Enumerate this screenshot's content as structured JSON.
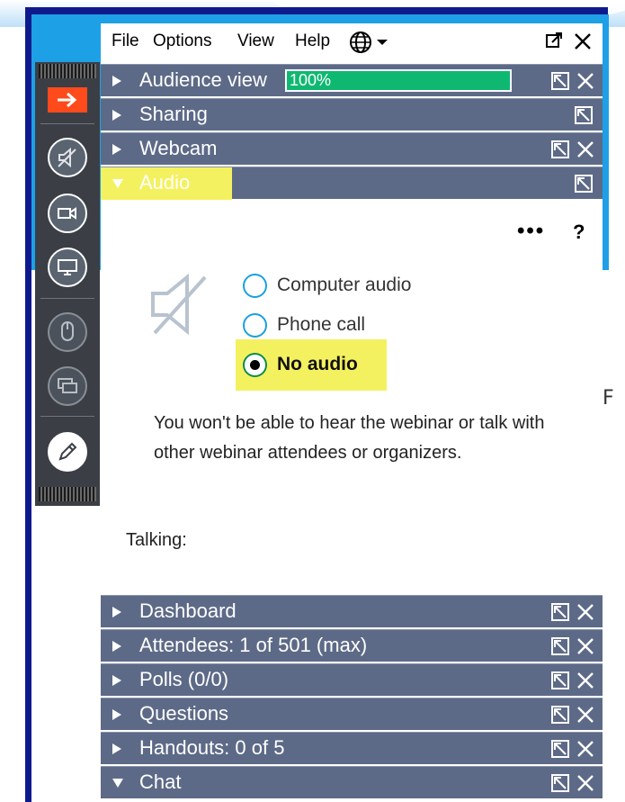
{
  "menu": {
    "file": "File",
    "options": "Options",
    "view": "View",
    "help": "Help"
  },
  "sections": {
    "audience_view": {
      "label": "Audience view",
      "meter_text": "100%",
      "meter_level_percent": 100
    },
    "sharing": {
      "label": "Sharing"
    },
    "webcam": {
      "label": "Webcam"
    },
    "audio": {
      "label": "Audio"
    },
    "dashboard": {
      "label": "Dashboard"
    },
    "attendees": {
      "label": "Attendees:  1 of 501 (max)"
    },
    "polls": {
      "label": "Polls (0/0)"
    },
    "questions": {
      "label": "Questions"
    },
    "handouts": {
      "label": "Handouts: 0 of 5"
    },
    "chat": {
      "label": "Chat"
    }
  },
  "audio": {
    "more_glyph": "•••",
    "help_glyph": "?",
    "options": [
      "Computer audio",
      "Phone call",
      "No audio"
    ],
    "selected": "No audio",
    "description": "You won't be able to hear the webinar or talk with other webinar attendees or organizers.",
    "talking_label": "Talking:"
  },
  "right_edge_letter": "F",
  "colors": {
    "section_bar": "#5d6a87",
    "highlight": "#f4f160",
    "meter": "#0fb871",
    "radio_border": "#1aa0df",
    "orange_accent": "#ff4a1c"
  },
  "icons": [
    "globe-icon",
    "popout-icon",
    "close-icon",
    "arrow-right-icon",
    "muted-speaker-icon",
    "webcam-icon",
    "screen-icon",
    "mouse-icon",
    "screens-icon",
    "pen-icon"
  ]
}
